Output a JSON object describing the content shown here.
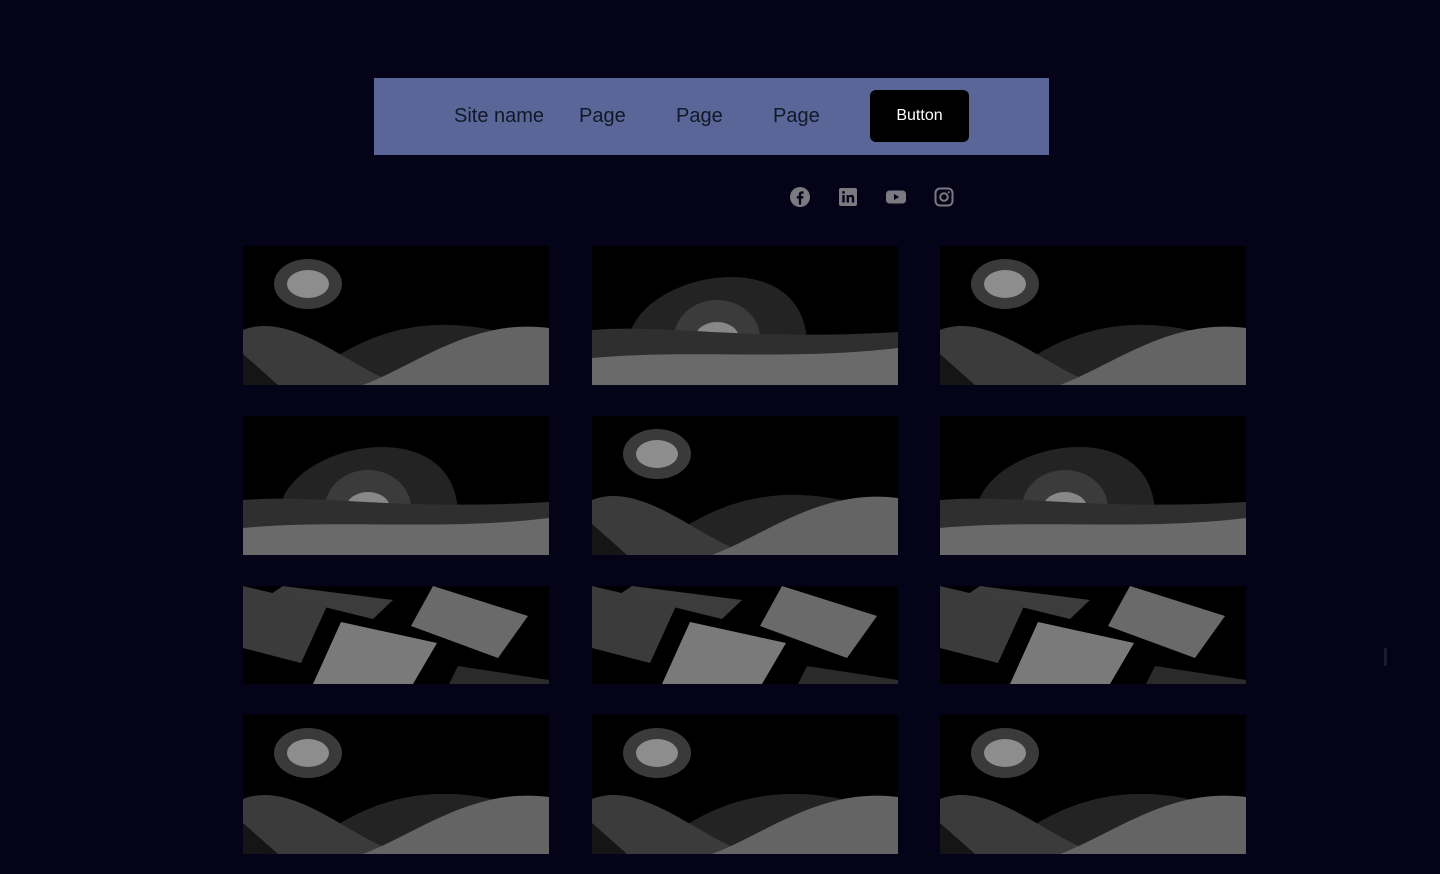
{
  "navbar": {
    "site_name": "Site name",
    "links": [
      "Page",
      "Page",
      "Page"
    ],
    "button_label": "Button",
    "background_color": "#5a6698"
  },
  "social": {
    "icons": [
      "facebook-icon",
      "linkedin-icon",
      "youtube-icon",
      "instagram-icon"
    ]
  },
  "gallery": {
    "rows": [
      [
        "image-placeholder-moon-hills",
        "image-placeholder-sunset",
        "image-placeholder-moon-hills"
      ],
      [
        "image-placeholder-sunset",
        "image-placeholder-moon-hills",
        "image-placeholder-sunset"
      ],
      [
        "image-placeholder-tiles",
        "image-placeholder-tiles",
        "image-placeholder-tiles"
      ],
      [
        "image-placeholder-moon-hills",
        "image-placeholder-moon-hills",
        "image-placeholder-moon-hills"
      ]
    ]
  },
  "colors": {
    "page_background": "#050318",
    "button_background": "#000000",
    "button_text": "#ffffff"
  }
}
